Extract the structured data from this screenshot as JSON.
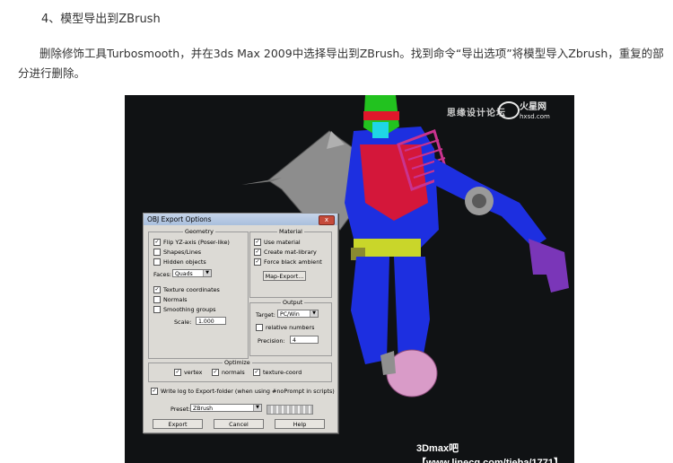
{
  "article": {
    "heading": "4、模型导出到ZBrush",
    "paragraph": "删除修饰工具Turbosmooth，并在3ds Max 2009中选择导出到ZBrush。找到命令“导出选项”将模型导入Zbrush，重复的部分进行删除。"
  },
  "figure": {
    "watermark_top_left": "思缘设计论坛",
    "watermark_top_logo": "火星网",
    "watermark_top_sub": "hxsd.com",
    "watermark_bottom": "3Dmax吧【www.linecg.com/tieba/1771】"
  },
  "dialog": {
    "title": "OBJ Export Options",
    "geometry_title": "Geometry",
    "flip_yz": "Flip YZ-axis (Poser-like)",
    "shapes_lines": "Shapes/Lines",
    "hidden_objects": "Hidden objects",
    "faces_label": "Faces:",
    "faces_value": "Quads",
    "texture_coordinates": "Texture coordinates",
    "normals": "Normals",
    "smoothing_groups": "Smoothing groups",
    "scale_label": "Scale:",
    "scale_value": "1.000",
    "material_title": "Material",
    "use_material": "Use material",
    "create_mat_library": "Create mat-library",
    "force_black_ambient": "Force black ambient",
    "map_export": "Map-Export...",
    "output_title": "Output",
    "target_label": "Target:",
    "target_value": "PC/Win",
    "relative_numbers": "relative numbers",
    "precision_label": "Precision:",
    "precision_value": "4",
    "optimize_title": "Optimize",
    "vertex": "vertex",
    "normals_opt": "normals",
    "texture_coord": "texture-coord",
    "write_log": "Write log to Export-folder (when using #noPrompt in scripts)",
    "preset_label": "Preset:",
    "preset_value": "ZBrush",
    "export_button": "Export",
    "cancel_button": "Cancel",
    "help_button": "Help",
    "close_glyph": "x"
  },
  "colors": {
    "figure_bg": "#101214",
    "body_blue": "#1d2fe0",
    "helmet_green": "#22c21f",
    "helmet_red": "#e0172b",
    "face_cyan": "#1fd6e6",
    "pink": "#c9338f",
    "purple": "#7a36b8",
    "belt_yellow": "#c9d62a",
    "grey_parts": "#9a9a9a",
    "pink_sphere": "#d99bc8"
  },
  "checkmark": "✓"
}
